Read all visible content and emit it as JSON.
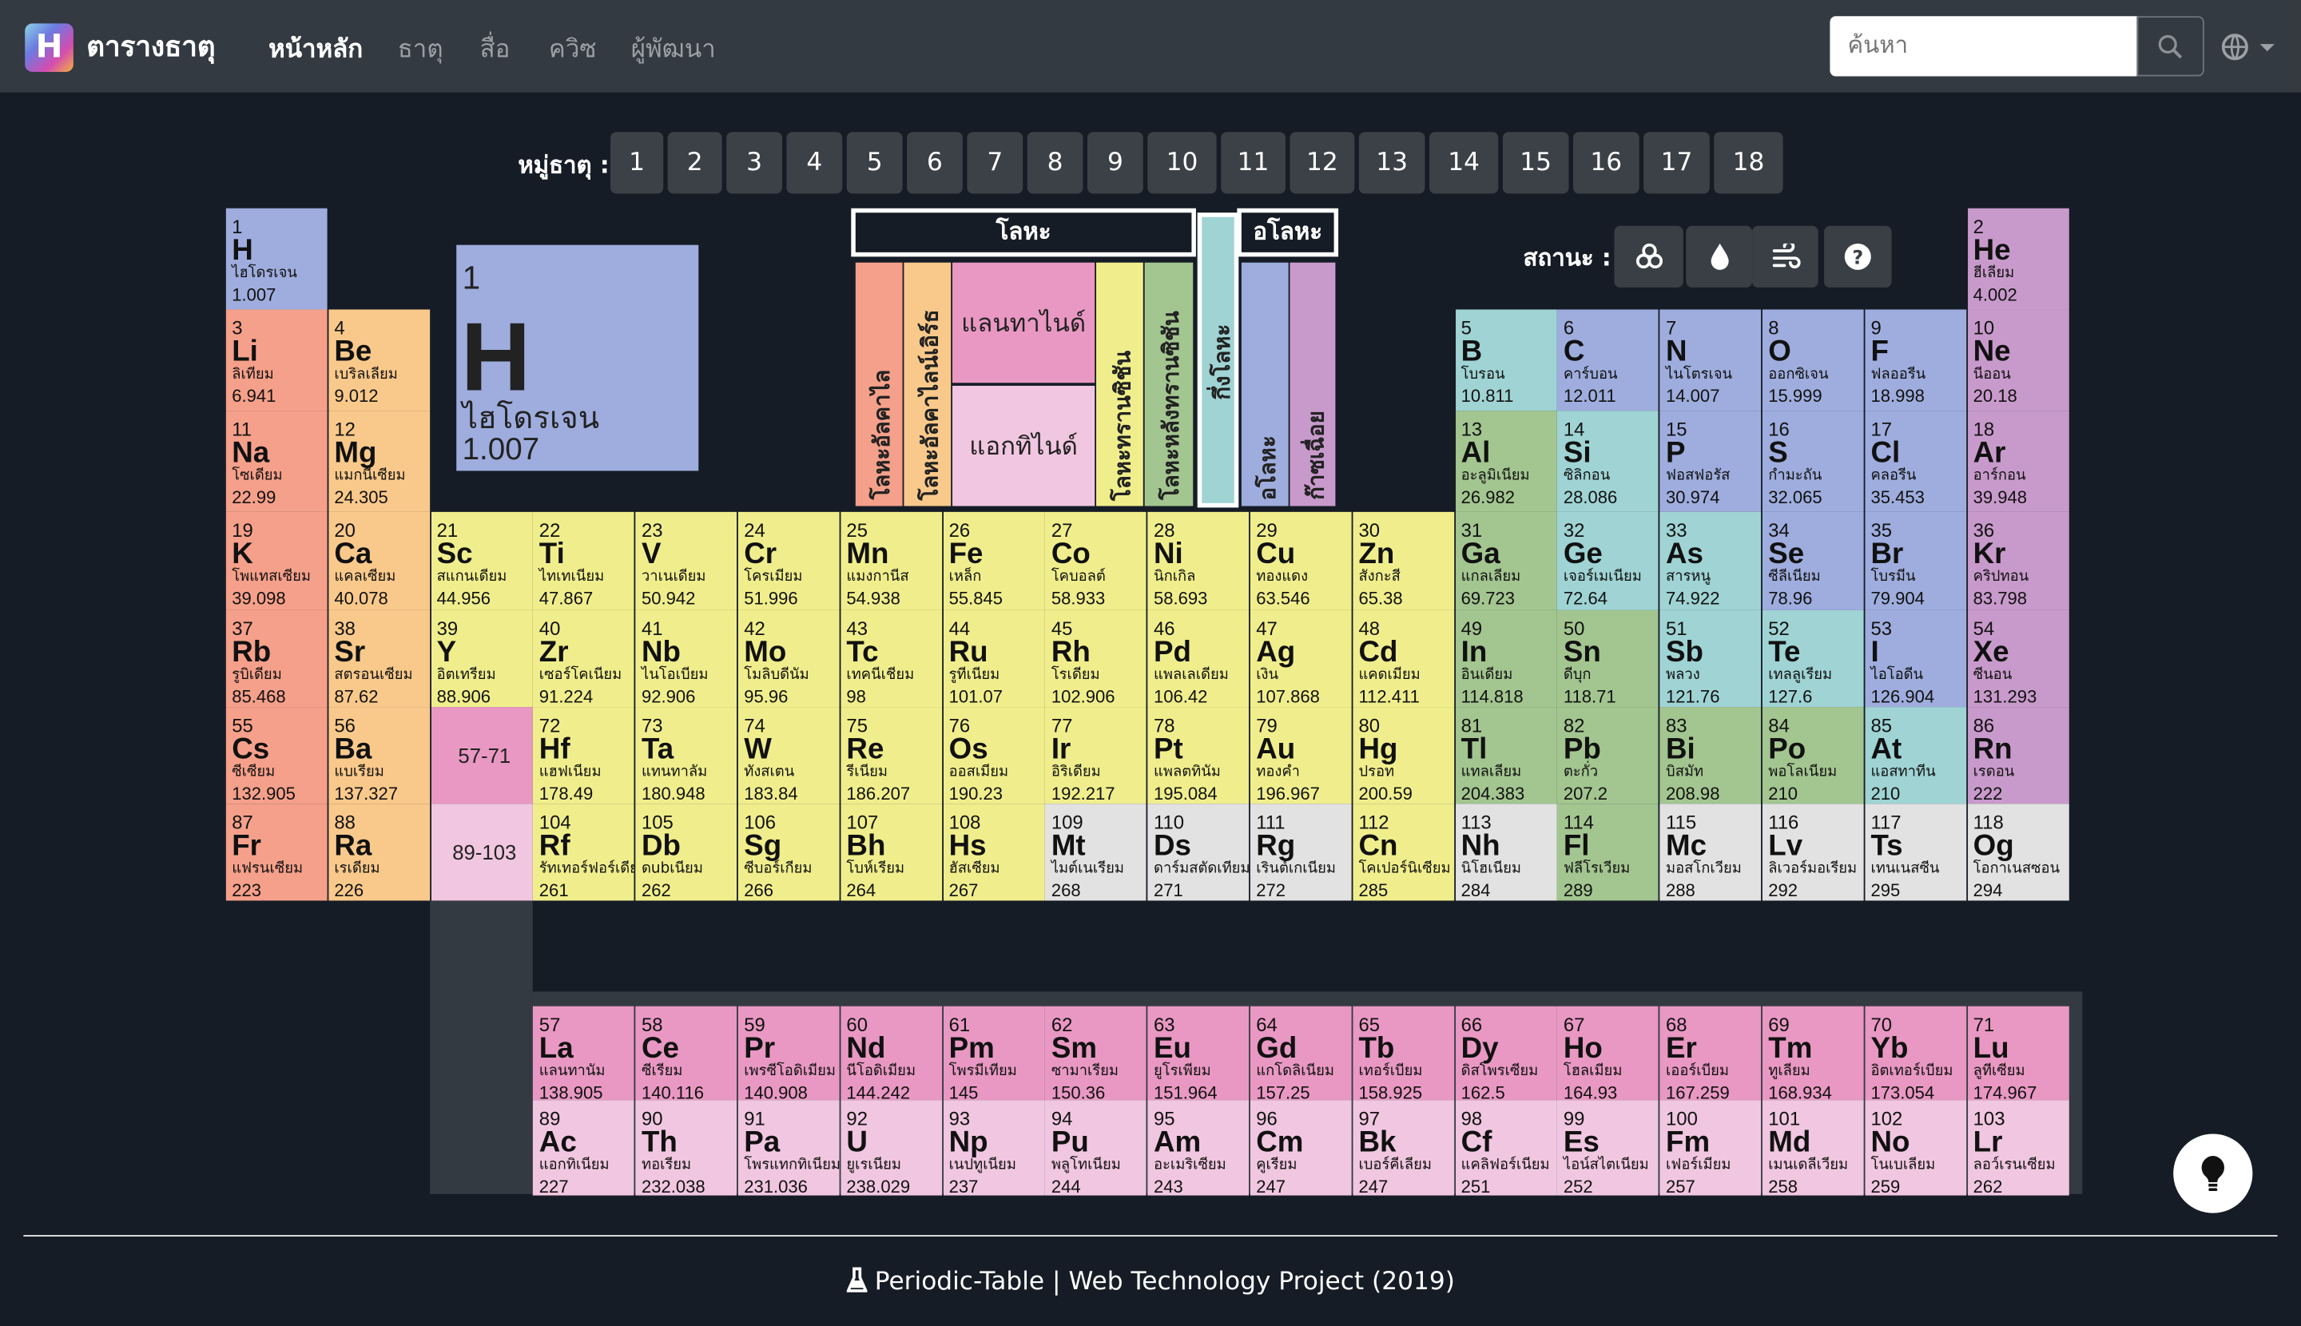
{
  "nav": {
    "logo": "H",
    "brand": "ตารางธาตุ",
    "links": [
      "หน้าหลัก",
      "ธาตุ",
      "สื่อ",
      "ควิซ",
      "ผู้พัฒนา"
    ],
    "search_placeholder": "ค้นหา"
  },
  "groups": {
    "label": "หมู่ธาตุ :",
    "items": [
      "1",
      "2",
      "3",
      "4",
      "5",
      "6",
      "7",
      "8",
      "9",
      "10",
      "11",
      "12",
      "13",
      "14",
      "15",
      "16",
      "17",
      "18"
    ]
  },
  "state": {
    "label": "สถานะ :",
    "buttons": [
      "solid-icon",
      "liquid-icon",
      "gas-icon",
      "unknown-icon"
    ]
  },
  "preview": {
    "number": "1",
    "symbol": "H",
    "name": "ไฮโดรเจน",
    "mass": "1.007"
  },
  "legend": {
    "metal": "โลหะ",
    "nonmetal": "อโลหะ",
    "alkali": "โลหะอัลคาไล",
    "alkaline": "โลหะอัลคาไลน์เอิร์ธ",
    "lanthanide": "แลนทาไนด์",
    "actinide": "แอกทิไนด์",
    "transition": "โลหะทรานซิชัน",
    "post": "โลหะหลังทรานซิชัน",
    "semi": "กึ่งโลหะ",
    "nonmetal_v": "อโลหะ",
    "halogen": "ก๊าซเฉื่อย"
  },
  "colors": {
    "alkali": "#f5a08a",
    "alkaline": "#f9c98b",
    "transition": "#f0ee8c",
    "post": "#a3c590",
    "metalloid": "#9fd3d4",
    "nonmetal": "#9eaddd",
    "noble": "#c89acb",
    "lanthanide": "#e898c2",
    "actinide": "#f0c6e0",
    "unknown": "#e2e2e2"
  },
  "range_labels": [
    "57-71",
    "89-103"
  ],
  "elements": [
    [
      "1",
      "H",
      "ไฮโดรเจน",
      "1.007",
      1,
      1,
      "nonmetal"
    ],
    [
      "2",
      "He",
      "ฮีเลียม",
      "4.002",
      18,
      1,
      "noble"
    ],
    [
      "3",
      "Li",
      "ลิเทียม",
      "6.941",
      1,
      2,
      "alkali"
    ],
    [
      "4",
      "Be",
      "เบริลเลียม",
      "9.012",
      2,
      2,
      "alkaline"
    ],
    [
      "5",
      "B",
      "โบรอน",
      "10.811",
      13,
      2,
      "metalloid"
    ],
    [
      "6",
      "C",
      "คาร์บอน",
      "12.011",
      14,
      2,
      "nonmetal"
    ],
    [
      "7",
      "N",
      "ไนโตรเจน",
      "14.007",
      15,
      2,
      "nonmetal"
    ],
    [
      "8",
      "O",
      "ออกซิเจน",
      "15.999",
      16,
      2,
      "nonmetal"
    ],
    [
      "9",
      "F",
      "ฟลออรีน",
      "18.998",
      17,
      2,
      "nonmetal"
    ],
    [
      "10",
      "Ne",
      "นีออน",
      "20.18",
      18,
      2,
      "noble"
    ],
    [
      "11",
      "Na",
      "โซเดียม",
      "22.99",
      1,
      3,
      "alkali"
    ],
    [
      "12",
      "Mg",
      "แมกนีเซียม",
      "24.305",
      2,
      3,
      "alkaline"
    ],
    [
      "13",
      "Al",
      "อะลูมิเนียม",
      "26.982",
      13,
      3,
      "post"
    ],
    [
      "14",
      "Si",
      "ซิลิกอน",
      "28.086",
      14,
      3,
      "metalloid"
    ],
    [
      "15",
      "P",
      "ฟอสฟอรัส",
      "30.974",
      15,
      3,
      "nonmetal"
    ],
    [
      "16",
      "S",
      "กำมะถัน",
      "32.065",
      16,
      3,
      "nonmetal"
    ],
    [
      "17",
      "Cl",
      "คลอรีน",
      "35.453",
      17,
      3,
      "nonmetal"
    ],
    [
      "18",
      "Ar",
      "อาร์กอน",
      "39.948",
      18,
      3,
      "noble"
    ],
    [
      "19",
      "K",
      "โพแทสเซียม",
      "39.098",
      1,
      4,
      "alkali"
    ],
    [
      "20",
      "Ca",
      "แคลเซียม",
      "40.078",
      2,
      4,
      "alkaline"
    ],
    [
      "21",
      "Sc",
      "สแกนเดียม",
      "44.956",
      3,
      4,
      "transition"
    ],
    [
      "22",
      "Ti",
      "ไทเทเนียม",
      "47.867",
      4,
      4,
      "transition"
    ],
    [
      "23",
      "V",
      "วาเนเดียม",
      "50.942",
      5,
      4,
      "transition"
    ],
    [
      "24",
      "Cr",
      "โครเมียม",
      "51.996",
      6,
      4,
      "transition"
    ],
    [
      "25",
      "Mn",
      "แมงกานีส",
      "54.938",
      7,
      4,
      "transition"
    ],
    [
      "26",
      "Fe",
      "เหล็ก",
      "55.845",
      8,
      4,
      "transition"
    ],
    [
      "27",
      "Co",
      "โคบอลต์",
      "58.933",
      9,
      4,
      "transition"
    ],
    [
      "28",
      "Ni",
      "นิกเกิล",
      "58.693",
      10,
      4,
      "transition"
    ],
    [
      "29",
      "Cu",
      "ทองแดง",
      "63.546",
      11,
      4,
      "transition"
    ],
    [
      "30",
      "Zn",
      "สังกะสี",
      "65.38",
      12,
      4,
      "transition"
    ],
    [
      "31",
      "Ga",
      "แกลเลียม",
      "69.723",
      13,
      4,
      "post"
    ],
    [
      "32",
      "Ge",
      "เจอร์เมเนียม",
      "72.64",
      14,
      4,
      "metalloid"
    ],
    [
      "33",
      "As",
      "สารหนู",
      "74.922",
      15,
      4,
      "metalloid"
    ],
    [
      "34",
      "Se",
      "ซีลีเนียม",
      "78.96",
      16,
      4,
      "nonmetal"
    ],
    [
      "35",
      "Br",
      "โบรมีน",
      "79.904",
      17,
      4,
      "nonmetal"
    ],
    [
      "36",
      "Kr",
      "คริปทอน",
      "83.798",
      18,
      4,
      "noble"
    ],
    [
      "37",
      "Rb",
      "รูบิเดียม",
      "85.468",
      1,
      5,
      "alkali"
    ],
    [
      "38",
      "Sr",
      "สตรอนเซียม",
      "87.62",
      2,
      5,
      "alkaline"
    ],
    [
      "39",
      "Y",
      "อิตเทรียม",
      "88.906",
      3,
      5,
      "transition"
    ],
    [
      "40",
      "Zr",
      "เซอร์โคเนียม",
      "91.224",
      4,
      5,
      "transition"
    ],
    [
      "41",
      "Nb",
      "ไนโอเบียม",
      "92.906",
      5,
      5,
      "transition"
    ],
    [
      "42",
      "Mo",
      "โมลิบดีนัม",
      "95.96",
      6,
      5,
      "transition"
    ],
    [
      "43",
      "Tc",
      "เทคนีเชียม",
      "98",
      7,
      5,
      "transition"
    ],
    [
      "44",
      "Ru",
      "รูทีเนียม",
      "101.07",
      8,
      5,
      "transition"
    ],
    [
      "45",
      "Rh",
      "โรเดียม",
      "102.906",
      9,
      5,
      "transition"
    ],
    [
      "46",
      "Pd",
      "แพลเลเดียม",
      "106.42",
      10,
      5,
      "transition"
    ],
    [
      "47",
      "Ag",
      "เงิน",
      "107.868",
      11,
      5,
      "transition"
    ],
    [
      "48",
      "Cd",
      "แคดเมียม",
      "112.411",
      12,
      5,
      "transition"
    ],
    [
      "49",
      "In",
      "อินเดียม",
      "114.818",
      13,
      5,
      "post"
    ],
    [
      "50",
      "Sn",
      "ดีบุก",
      "118.71",
      14,
      5,
      "post"
    ],
    [
      "51",
      "Sb",
      "พลวง",
      "121.76",
      15,
      5,
      "metalloid"
    ],
    [
      "52",
      "Te",
      "เทลลูเรียม",
      "127.6",
      16,
      5,
      "metalloid"
    ],
    [
      "53",
      "I",
      "ไอโอดีน",
      "126.904",
      17,
      5,
      "nonmetal"
    ],
    [
      "54",
      "Xe",
      "ซีนอน",
      "131.293",
      18,
      5,
      "noble"
    ],
    [
      "55",
      "Cs",
      "ซีเซียม",
      "132.905",
      1,
      6,
      "alkali"
    ],
    [
      "56",
      "Ba",
      "แบเรียม",
      "137.327",
      2,
      6,
      "alkaline"
    ],
    [
      "72",
      "Hf",
      "แฮฟเนียม",
      "178.49",
      4,
      6,
      "transition"
    ],
    [
      "73",
      "Ta",
      "แทนทาลัม",
      "180.948",
      5,
      6,
      "transition"
    ],
    [
      "74",
      "W",
      "ทังสเตน",
      "183.84",
      6,
      6,
      "transition"
    ],
    [
      "75",
      "Re",
      "รีเนียม",
      "186.207",
      7,
      6,
      "transition"
    ],
    [
      "76",
      "Os",
      "ออสเมียม",
      "190.23",
      8,
      6,
      "transition"
    ],
    [
      "77",
      "Ir",
      "อิริเดียม",
      "192.217",
      9,
      6,
      "transition"
    ],
    [
      "78",
      "Pt",
      "แพลตทินัม",
      "195.084",
      10,
      6,
      "transition"
    ],
    [
      "79",
      "Au",
      "ทองคำ",
      "196.967",
      11,
      6,
      "transition"
    ],
    [
      "80",
      "Hg",
      "ปรอท",
      "200.59",
      12,
      6,
      "transition"
    ],
    [
      "81",
      "Tl",
      "แทลเลียม",
      "204.383",
      13,
      6,
      "post"
    ],
    [
      "82",
      "Pb",
      "ตะกั่ว",
      "207.2",
      14,
      6,
      "post"
    ],
    [
      "83",
      "Bi",
      "บิสมัท",
      "208.98",
      15,
      6,
      "post"
    ],
    [
      "84",
      "Po",
      "พอโลเนียม",
      "210",
      16,
      6,
      "post"
    ],
    [
      "85",
      "At",
      "แอสทาทีน",
      "210",
      17,
      6,
      "metalloid"
    ],
    [
      "86",
      "Rn",
      "เรดอน",
      "222",
      18,
      6,
      "noble"
    ],
    [
      "87",
      "Fr",
      "แฟรนเซียม",
      "223",
      1,
      7,
      "alkali"
    ],
    [
      "88",
      "Ra",
      "เรเดียม",
      "226",
      2,
      7,
      "alkaline"
    ],
    [
      "104",
      "Rf",
      "รัทเทอร์ฟอร์เดียม",
      "261",
      4,
      7,
      "transition"
    ],
    [
      "105",
      "Db",
      "ดubเนียม",
      "262",
      5,
      7,
      "transition"
    ],
    [
      "106",
      "Sg",
      "ซีบอร์เกียม",
      "266",
      6,
      7,
      "transition"
    ],
    [
      "107",
      "Bh",
      "โบห์เรียม",
      "264",
      7,
      7,
      "transition"
    ],
    [
      "108",
      "Hs",
      "ฮัสเซียม",
      "267",
      8,
      7,
      "transition"
    ],
    [
      "109",
      "Mt",
      "ไมต์เนเรียม",
      "268",
      9,
      7,
      "unknown"
    ],
    [
      "110",
      "Ds",
      "ดาร์มสตัดเทียม",
      "271",
      10,
      7,
      "unknown"
    ],
    [
      "111",
      "Rg",
      "เรินต์เกเนียม",
      "272",
      11,
      7,
      "unknown"
    ],
    [
      "112",
      "Cn",
      "โคเปอร์นิเซียม",
      "285",
      12,
      7,
      "transition"
    ],
    [
      "113",
      "Nh",
      "นิโฮเนียม",
      "284",
      13,
      7,
      "unknown"
    ],
    [
      "114",
      "Fl",
      "ฟลีโรเวียม",
      "289",
      14,
      7,
      "post"
    ],
    [
      "115",
      "Mc",
      "มอสโกเวียม",
      "288",
      15,
      7,
      "unknown"
    ],
    [
      "116",
      "Lv",
      "ลิเวอร์มอเรียม",
      "292",
      16,
      7,
      "unknown"
    ],
    [
      "117",
      "Ts",
      "เทนเนสซีน",
      "295",
      17,
      7,
      "unknown"
    ],
    [
      "118",
      "Og",
      "โอกาเนสซอน",
      "294",
      18,
      7,
      "unknown"
    ],
    [
      "57",
      "La",
      "แลนทานัม",
      "138.905",
      4,
      9,
      "lanthanide"
    ],
    [
      "58",
      "Ce",
      "ซีเรียม",
      "140.116",
      5,
      9,
      "lanthanide"
    ],
    [
      "59",
      "Pr",
      "เพรซีโอดิเมียม",
      "140.908",
      6,
      9,
      "lanthanide"
    ],
    [
      "60",
      "Nd",
      "นีโอดิเมียม",
      "144.242",
      7,
      9,
      "lanthanide"
    ],
    [
      "61",
      "Pm",
      "โพรมีเทียม",
      "145",
      8,
      9,
      "lanthanide"
    ],
    [
      "62",
      "Sm",
      "ซามาเรียม",
      "150.36",
      9,
      9,
      "lanthanide"
    ],
    [
      "63",
      "Eu",
      "ยูโรเพียม",
      "151.964",
      10,
      9,
      "lanthanide"
    ],
    [
      "64",
      "Gd",
      "แกโดลิเนียม",
      "157.25",
      11,
      9,
      "lanthanide"
    ],
    [
      "65",
      "Tb",
      "เทอร์เบียม",
      "158.925",
      12,
      9,
      "lanthanide"
    ],
    [
      "66",
      "Dy",
      "ดิสโพรเซียม",
      "162.5",
      13,
      9,
      "lanthanide"
    ],
    [
      "67",
      "Ho",
      "โฮลเมียม",
      "164.93",
      14,
      9,
      "lanthanide"
    ],
    [
      "68",
      "Er",
      "เออร์เบียม",
      "167.259",
      15,
      9,
      "lanthanide"
    ],
    [
      "69",
      "Tm",
      "ทูเลียม",
      "168.934",
      16,
      9,
      "lanthanide"
    ],
    [
      "70",
      "Yb",
      "อิตเทอร์เบียม",
      "173.054",
      17,
      9,
      "lanthanide"
    ],
    [
      "71",
      "Lu",
      "ลูทีเซียม",
      "174.967",
      18,
      9,
      "lanthanide"
    ],
    [
      "89",
      "Ac",
      "แอกทิเนียม",
      "227",
      4,
      10,
      "actinide"
    ],
    [
      "90",
      "Th",
      "ทอเรียม",
      "232.038",
      5,
      10,
      "actinide"
    ],
    [
      "91",
      "Pa",
      "โพรแทกทิเนียม",
      "231.036",
      6,
      10,
      "actinide"
    ],
    [
      "92",
      "U",
      "ยูเรเนียม",
      "238.029",
      7,
      10,
      "actinide"
    ],
    [
      "93",
      "Np",
      "เนปทูเนียม",
      "237",
      8,
      10,
      "actinide"
    ],
    [
      "94",
      "Pu",
      "พลูโทเนียม",
      "244",
      9,
      10,
      "actinide"
    ],
    [
      "95",
      "Am",
      "อะเมริเซียม",
      "243",
      10,
      10,
      "actinide"
    ],
    [
      "96",
      "Cm",
      "คูเรียม",
      "247",
      11,
      10,
      "actinide"
    ],
    [
      "97",
      "Bk",
      "เบอร์คีเลียม",
      "247",
      12,
      10,
      "actinide"
    ],
    [
      "98",
      "Cf",
      "แคลิฟอร์เนียม",
      "251",
      13,
      10,
      "actinide"
    ],
    [
      "99",
      "Es",
      "ไอน์สไตเนียม",
      "252",
      14,
      10,
      "actinide"
    ],
    [
      "100",
      "Fm",
      "เฟอร์เมียม",
      "257",
      15,
      10,
      "actinide"
    ],
    [
      "101",
      "Md",
      "เมนเดลีเวียม",
      "258",
      16,
      10,
      "actinide"
    ],
    [
      "102",
      "No",
      "โนเบเลียม",
      "259",
      17,
      10,
      "actinide"
    ],
    [
      "103",
      "Lr",
      "ลอว์เรนเซียม",
      "262",
      18,
      10,
      "actinide"
    ]
  ],
  "footer": "Periodic-Table | Web Technology Project (2019)"
}
